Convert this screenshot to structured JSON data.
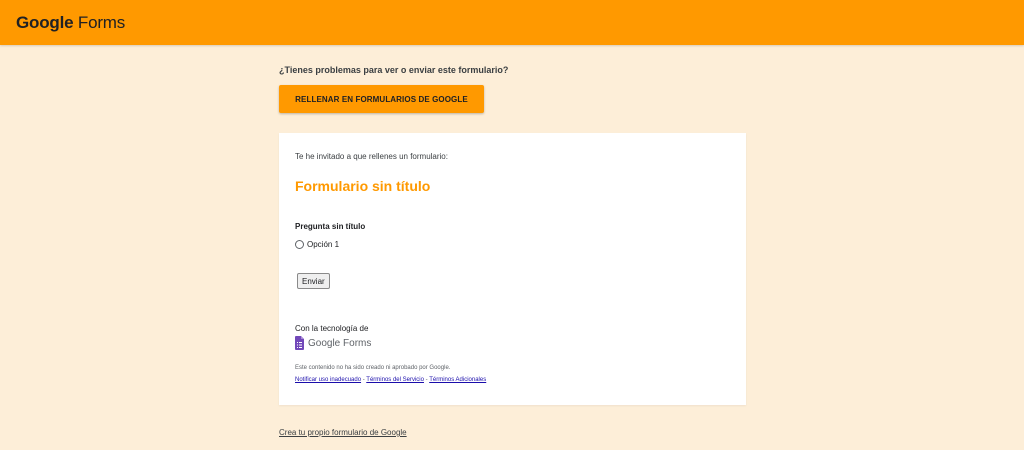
{
  "header": {
    "brand_google": "Google",
    "brand_forms": "Forms",
    "bar_color": "#ff9900"
  },
  "trouble": {
    "text": "¿Tienes problemas para ver o enviar este formulario?",
    "button_label": "RELLENAR EN FORMULARIOS DE GOOGLE"
  },
  "card": {
    "invite_text": "Te he invitado a que rellenes un formulario:",
    "form_title": "Formulario sin título",
    "question_title": "Pregunta sin título",
    "options": [
      "Opción 1"
    ],
    "submit_label": "Enviar",
    "powered_by": "Con la tecnología de",
    "logo_text": "Google Forms",
    "disclaimer": "Este contenido no ha sido creado ni aprobado por Google.",
    "links": {
      "report": "Notificar uso inadecuado",
      "sep1": " - ",
      "terms": "Términos del Servicio",
      "sep2": " - ",
      "additional": "Términos Adicionales"
    }
  },
  "footer": {
    "create_link": "Crea tu propio formulario de Google"
  },
  "colors": {
    "accent": "#ff9900",
    "background": "#fdeed8",
    "link": "#1a0dab"
  },
  "icons": {
    "forms_logo": "google-forms-icon",
    "radio": "radio-unchecked-icon"
  }
}
